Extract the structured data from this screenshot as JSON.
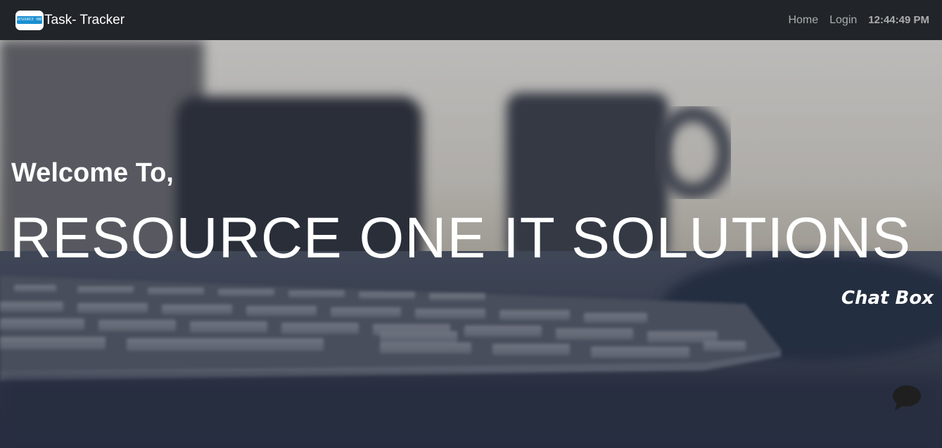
{
  "navbar": {
    "logo_text": "RESOURCE ONE",
    "brand": "Task- Tracker",
    "links": [
      {
        "label": "Home"
      },
      {
        "label": "Login"
      }
    ],
    "clock": "12:44:49 PM"
  },
  "hero": {
    "welcome": "Welcome To,",
    "company": "RESOURCE ONE IT SOLUTIONS",
    "chat_label": "Chat Box"
  },
  "icons": {
    "chat": "speech-bubble-icon"
  },
  "colors": {
    "navbar_bg": "#212529",
    "nav_text": "#9a9c9e",
    "hero_text": "#ffffff",
    "chat_icon": "#1f1f1f"
  }
}
